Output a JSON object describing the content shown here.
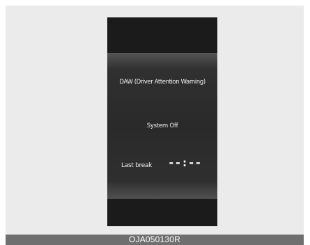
{
  "display": {
    "title": "DAW (Driver Attention Warning)",
    "status": "System Off",
    "last_break_label": "Last break",
    "last_break_value": "--:--"
  },
  "footer": {
    "code": "OJA050130R"
  },
  "colors": {
    "frame_background": "#ebebeb",
    "display_background": "#1d1d1d",
    "text": "#f0f0f0",
    "footer_bar": "#6f6f6f"
  }
}
